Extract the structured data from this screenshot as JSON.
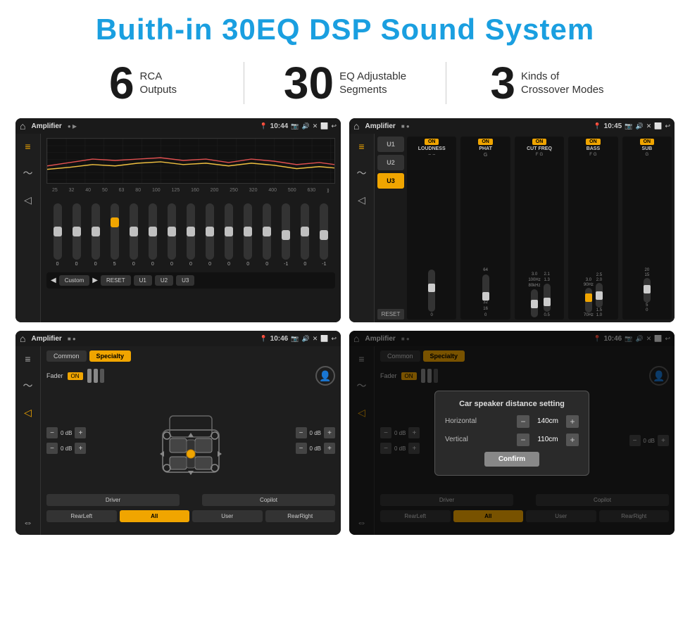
{
  "page": {
    "title": "Buith-in 30EQ DSP Sound System"
  },
  "stats": [
    {
      "number": "6",
      "text_line1": "RCA",
      "text_line2": "Outputs"
    },
    {
      "number": "30",
      "text_line1": "EQ Adjustable",
      "text_line2": "Segments"
    },
    {
      "number": "3",
      "text_line1": "Kinds of",
      "text_line2": "Crossover Modes"
    }
  ],
  "screens": {
    "eq_screen": {
      "status_title": "Amplifier",
      "status_time": "10:44",
      "eq_labels": [
        "25",
        "32",
        "40",
        "50",
        "63",
        "80",
        "100",
        "125",
        "160",
        "200",
        "250",
        "320",
        "400",
        "500",
        "630"
      ],
      "eq_values": [
        "0",
        "0",
        "0",
        "5",
        "0",
        "0",
        "0",
        "0",
        "0",
        "0",
        "0",
        "0",
        "-1",
        "0",
        "-1"
      ],
      "eq_preset": "Custom",
      "buttons": [
        "RESET",
        "U1",
        "U2",
        "U3"
      ]
    },
    "crossover_screen": {
      "status_title": "Amplifier",
      "status_time": "10:45",
      "units": [
        "U1",
        "U2",
        "U3"
      ],
      "channels": [
        {
          "label": "LOUDNESS",
          "on": true
        },
        {
          "label": "PHAT",
          "on": true
        },
        {
          "label": "CUT FREQ",
          "on": true
        },
        {
          "label": "BASS",
          "on": true
        },
        {
          "label": "SUB",
          "on": true
        }
      ],
      "reset_label": "RESET"
    },
    "speaker_screen1": {
      "status_title": "Amplifier",
      "status_time": "10:46",
      "tabs": [
        "Common",
        "Specialty"
      ],
      "active_tab": "Specialty",
      "fader_label": "Fader",
      "fader_on": "ON",
      "db_values": [
        "0 dB",
        "0 dB",
        "0 dB",
        "0 dB"
      ],
      "bottom_buttons": [
        "Driver",
        "",
        "Copilot",
        "RearLeft",
        "All",
        "User",
        "RearRight"
      ]
    },
    "speaker_screen2": {
      "status_title": "Amplifier",
      "status_time": "10:46",
      "tabs": [
        "Common",
        "Specialty"
      ],
      "dialog": {
        "title": "Car speaker distance setting",
        "horizontal_label": "Horizontal",
        "horizontal_value": "140cm",
        "vertical_label": "Vertical",
        "vertical_value": "110cm",
        "confirm_label": "Confirm"
      },
      "db_values": [
        "0 dB",
        "0 dB"
      ],
      "bottom_buttons": [
        "Driver",
        "Copilot",
        "RearLeft",
        "User",
        "RearRight"
      ]
    }
  }
}
